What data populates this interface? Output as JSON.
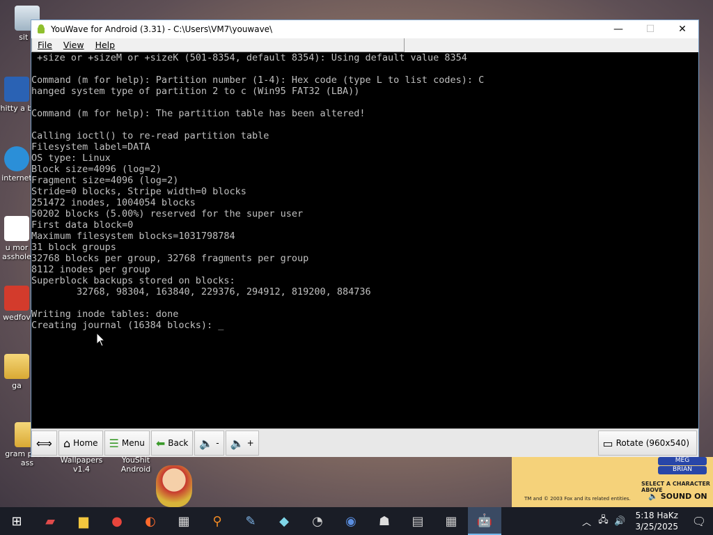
{
  "desktop": {
    "icons": [
      {
        "label": "sit b"
      },
      {
        "label": "shitty a ba"
      },
      {
        "label": "internet"
      },
      {
        "label": "u mor asshole"
      },
      {
        "label": "wedfov"
      },
      {
        "label": "ga"
      },
      {
        "label": "gram pacer ass"
      },
      {
        "label": "Wallpapers v1.4"
      },
      {
        "label": "YouShit Android"
      }
    ],
    "overlay": {
      "select_text": "SELECT A CHARACTER ABOVE",
      "sound_label": "SOUND ON",
      "copyright": "TM and © 2003 Fox and its related entities.",
      "buttons": [
        "MEG",
        "BRIAN"
      ]
    }
  },
  "window": {
    "title": "YouWave for Android (3.31) - C:\\Users\\VM7\\youwave\\",
    "menu": [
      "File",
      "View",
      "Help"
    ]
  },
  "terminal": {
    "lines": [
      " +size or +sizeM or +sizeK (501-8354, default 8354): Using default value 8354",
      "",
      "Command (m for help): Partition number (1-4): Hex code (type L to list codes): C",
      "hanged system type of partition 2 to c (Win95 FAT32 (LBA))",
      "",
      "Command (m for help): The partition table has been altered!",
      "",
      "Calling ioctl() to re-read partition table",
      "Filesystem label=DATA",
      "OS type: Linux",
      "Block size=4096 (log=2)",
      "Fragment size=4096 (log=2)",
      "Stride=0 blocks, Stripe width=0 blocks",
      "251472 inodes, 1004054 blocks",
      "50202 blocks (5.00%) reserved for the super user",
      "First data block=0",
      "Maximum filesystem blocks=1031798784",
      "31 block groups",
      "32768 blocks per group, 32768 fragments per group",
      "8112 inodes per group",
      "Superblock backups stored on blocks:",
      "        32768, 98304, 163840, 229376, 294912, 819200, 884736",
      "",
      "Writing inode tables: done",
      "Creating journal (16384 blocks): _"
    ]
  },
  "toolbar": {
    "home": "Home",
    "menu": "Menu",
    "back": "Back",
    "vol_down": "-",
    "vol_up": "+",
    "rotate": "Rotate (960x540)"
  },
  "taskbar": {
    "time": "5:18 HaKz",
    "date": "3/25/2025"
  }
}
